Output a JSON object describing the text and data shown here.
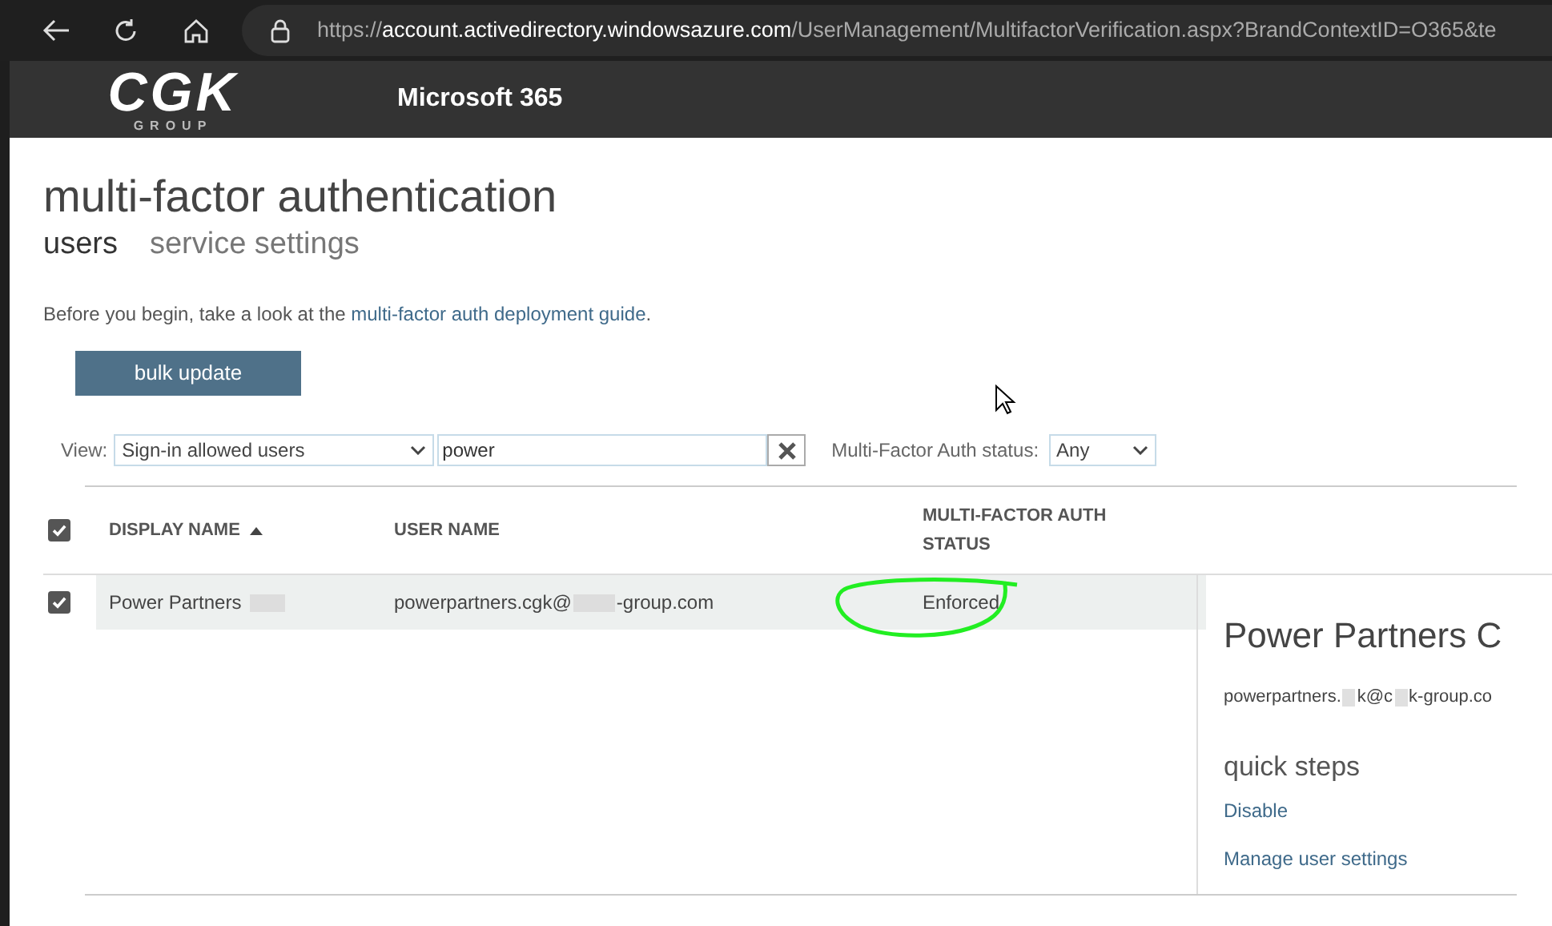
{
  "browser": {
    "url_scheme": "https://",
    "url_host": "account.activedirectory.windowsazure.com",
    "url_path": "/UserManagement/MultifactorVerification.aspx?BrandContextID=O365&te"
  },
  "header": {
    "logo_sub": "GROUP",
    "logo": "CGK",
    "product": "Microsoft 365"
  },
  "page": {
    "title": "multi-factor authentication",
    "tabs": [
      {
        "label": "users",
        "selected": true
      },
      {
        "label": "service settings",
        "selected": false
      }
    ],
    "intro": "Before you begin, take a look at the ",
    "intro_link": "multi-factor auth deployment guide",
    "intro_end": ".",
    "bulk_button": "bulk update"
  },
  "filters": {
    "view_label": "View:",
    "view_value": "Sign-in allowed users",
    "search_value": "power",
    "status_label": "Multi-Factor Auth status:",
    "status_value": "Any"
  },
  "table": {
    "select_all_checked": true,
    "columns": [
      {
        "label": "DISPLAY NAME",
        "sorted": true
      },
      {
        "label": "USER NAME",
        "sorted": false
      },
      {
        "label": "MULTI-FACTOR AUTH STATUS",
        "sorted": false
      }
    ],
    "rows": [
      {
        "checked": true,
        "selected": true,
        "display_name": "Power Partners",
        "user_name_before": "powerpartners.cgk@",
        "user_name_after": "-group.com",
        "status": "Enforced"
      }
    ]
  },
  "detail": {
    "title": "Power Partners C",
    "email_parts": [
      "powerpartners.",
      "k@c",
      "k-group.co"
    ],
    "quick_steps_title": "quick steps",
    "actions": [
      "Disable",
      "Manage user settings"
    ]
  }
}
